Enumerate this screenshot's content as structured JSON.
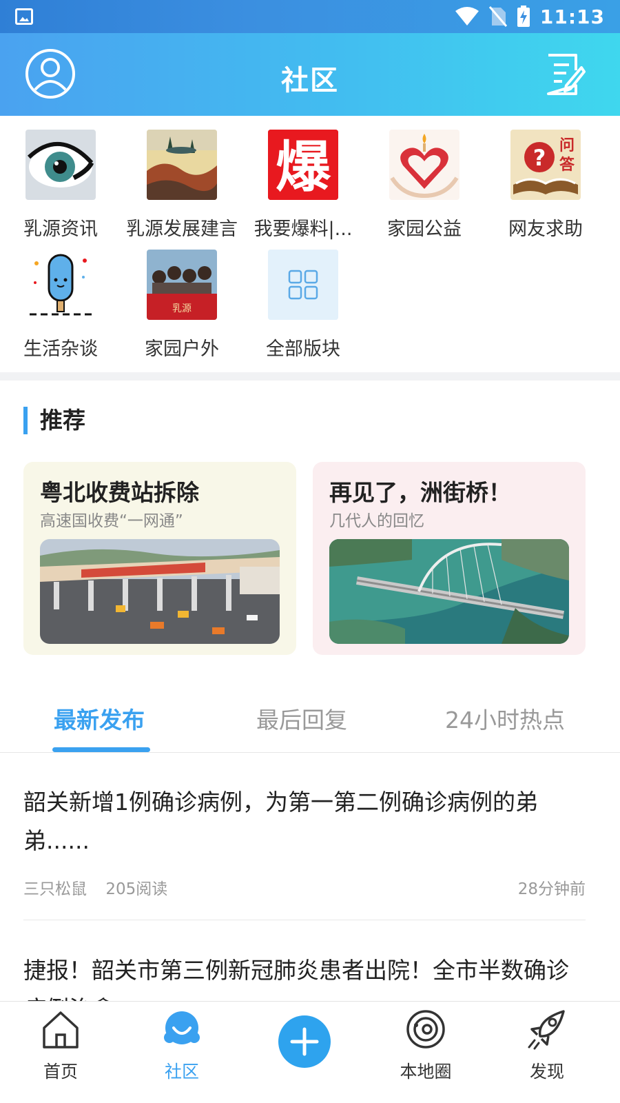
{
  "status_bar": {
    "time": "11:13"
  },
  "header": {
    "title": "社区"
  },
  "categories": [
    {
      "label": "乳源资讯",
      "icon": "eye-icon"
    },
    {
      "label": "乳源发展建言",
      "icon": "landscape-painting-icon"
    },
    {
      "label": "我要爆料|...",
      "icon": "bao-character-icon"
    },
    {
      "label": "家园公益",
      "icon": "heart-hands-icon"
    },
    {
      "label": "网友求助",
      "icon": "question-book-icon"
    },
    {
      "label": "生活杂谈",
      "icon": "popsicle-icon"
    },
    {
      "label": "家园户外",
      "icon": "group-photo-icon"
    },
    {
      "label": "全部版块",
      "icon": "grid-icon"
    }
  ],
  "recommend": {
    "title": "推荐",
    "cards": [
      {
        "title": "粤北收费站拆除",
        "subtitle": "高速国收费“一网通”",
        "bg": "#f8f7e8"
      },
      {
        "title": "再见了，洲街桥！",
        "subtitle": "几代人的回忆",
        "bg": "#fbeef0"
      }
    ]
  },
  "tabs": [
    {
      "label": "最新发布",
      "active": true
    },
    {
      "label": "最后回复",
      "active": false
    },
    {
      "label": "24小时热点",
      "active": false
    }
  ],
  "posts": [
    {
      "title": "韶关新增1例确诊病例，为第一第二例确诊病例的弟弟......",
      "author": "三只松鼠",
      "reads": "205阅读",
      "time": "28分钟前"
    },
    {
      "title": "捷报！韶关市第三例新冠肺炎患者出院！全市半数确诊病例治愈"
    }
  ],
  "bottom_nav": [
    {
      "label": "首页",
      "icon": "home-icon",
      "active": false
    },
    {
      "label": "社区",
      "icon": "community-icon",
      "active": true
    },
    {
      "label": "",
      "icon": "plus-icon",
      "active": false
    },
    {
      "label": "本地圈",
      "icon": "planet-icon",
      "active": false
    },
    {
      "label": "发现",
      "icon": "rocket-icon",
      "active": false
    }
  ],
  "colors": {
    "accent": "#3aa1f0",
    "header_start": "#4aa2f0",
    "header_end": "#3fd7ee"
  }
}
